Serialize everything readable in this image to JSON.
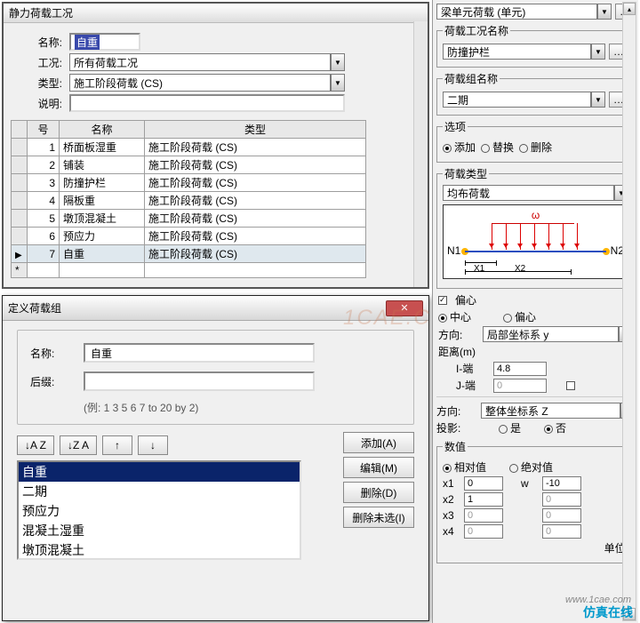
{
  "panel1": {
    "title": "静力荷载工况",
    "labels": {
      "name": "名称:",
      "case": "工况:",
      "type": "类型:",
      "desc": "说明:"
    },
    "values": {
      "name": "自重",
      "case": "所有荷载工况",
      "type": "施工阶段荷载 (CS)",
      "desc": ""
    },
    "headers": {
      "no": "号",
      "name": "名称",
      "type": "类型"
    },
    "rows": [
      {
        "no": "1",
        "name": "桥面板湿重",
        "type": "施工阶段荷载 (CS)"
      },
      {
        "no": "2",
        "name": "铺装",
        "type": "施工阶段荷载 (CS)"
      },
      {
        "no": "3",
        "name": "防撞护栏",
        "type": "施工阶段荷载 (CS)"
      },
      {
        "no": "4",
        "name": "隔板重",
        "type": "施工阶段荷载 (CS)"
      },
      {
        "no": "5",
        "name": "墩顶混凝土",
        "type": "施工阶段荷载 (CS)"
      },
      {
        "no": "6",
        "name": "预应力",
        "type": "施工阶段荷载 (CS)"
      },
      {
        "no": "7",
        "name": "自重",
        "type": "施工阶段荷载 (CS)"
      }
    ]
  },
  "panel2": {
    "title": "定义荷载组",
    "labels": {
      "name": "名称:",
      "suffix": "后缀:"
    },
    "values": {
      "name": "自重",
      "suffix": ""
    },
    "hint": "(例: 1 3 5 6 7 to 20 by 2)",
    "buttons": {
      "add": "添加(A)",
      "edit": "编辑(M)",
      "del": "删除(D)",
      "delUnsel": "删除未选(I)"
    },
    "sort": {
      "az": "↓A Z",
      "za": "↓Z A",
      "up": "↑",
      "down": "↓"
    },
    "items": [
      "自重",
      "二期",
      "预应力",
      "混凝土湿重",
      "墩顶混凝土"
    ]
  },
  "right": {
    "top": "梁单元荷载 (单元)",
    "lcName": {
      "legend": "荷载工况名称",
      "value": "防撞护栏"
    },
    "lgName": {
      "legend": "荷载组名称",
      "value": "二期"
    },
    "options": {
      "legend": "选项",
      "add": "添加",
      "replace": "替换",
      "delete": "删除"
    },
    "ltype": {
      "legend": "荷载类型",
      "value": "均布荷载"
    },
    "diagram": {
      "w": "ω",
      "n1": "N1",
      "n2": "N2",
      "x1": "X1",
      "x2": "X2"
    },
    "ecc": {
      "chk": "偏心",
      "center": "中心",
      "off": "偏心",
      "dirLabel": "方向:",
      "dir": "局部坐标系 y",
      "distLabel": "距离(m)",
      "iend": "I-端",
      "jend": "J-端",
      "iVal": "4.8",
      "jVal": "0"
    },
    "dir2": {
      "label": "方向:",
      "value": "整体坐标系 Z"
    },
    "proj": {
      "label": "投影:",
      "yes": "是",
      "no": "否"
    },
    "nums": {
      "legend": "数值",
      "rel": "相对值",
      "abs": "绝对值",
      "x1": "0",
      "x2": "1",
      "x3": "0",
      "x4": "0",
      "w": "-10",
      "zero": "0",
      "unit": "单位:"
    }
  },
  "watermark": {
    "url": "www.1cae.com",
    "text": "仿真在线",
    "faded": "1CAE.C"
  }
}
